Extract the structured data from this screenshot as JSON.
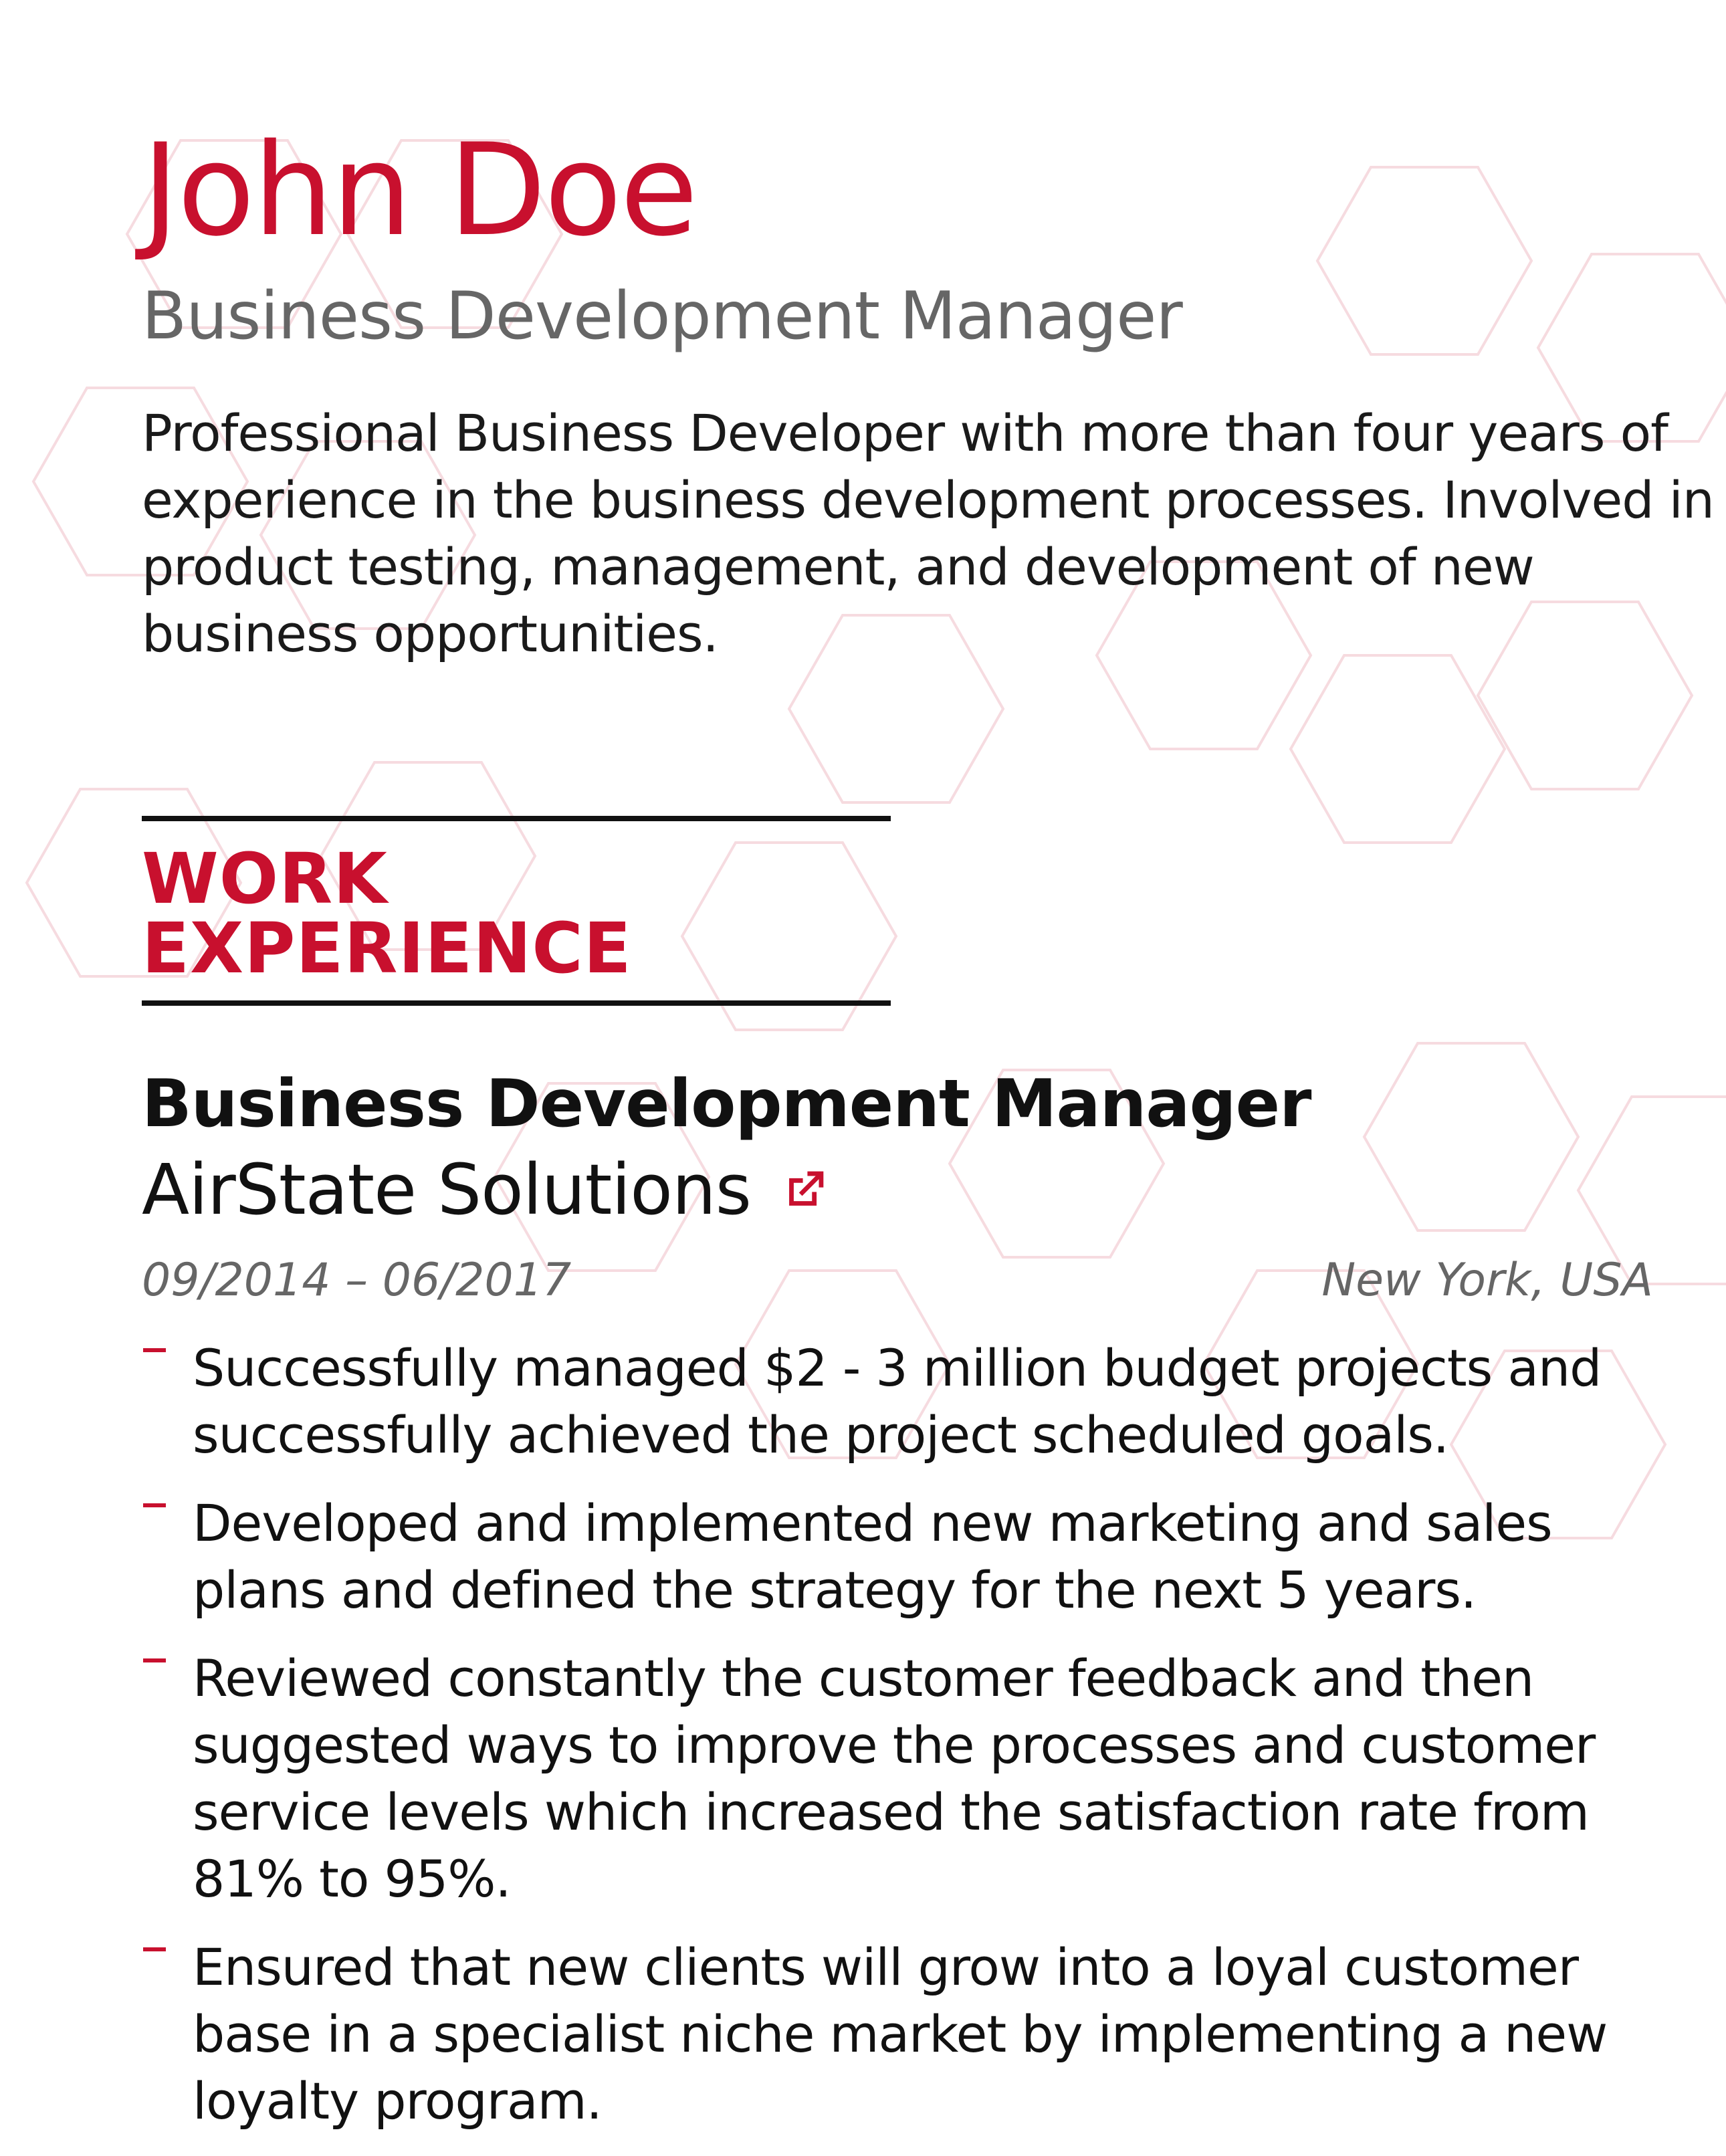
{
  "person": {
    "name": "John Doe",
    "headline": "Business Development Manager",
    "summary_lines": [
      "Professional Business Developer with more than four years of",
      "experience in the business development processes. Involved in",
      "product testing, management, and development of new",
      "business opportunities."
    ]
  },
  "work_experience": {
    "section_title": "WORK EXPERIENCE",
    "jobs": [
      {
        "title": "Business Development Manager",
        "company": "AirState Solutions",
        "dates": "09/2014 – 06/2017",
        "location": "New York, USA",
        "bullets": [
          {
            "lines": [
              "Successfully managed $2 - 3 million budget projects and",
              "successfully achieved the project scheduled goals."
            ]
          },
          {
            "lines": [
              "Developed and implemented new marketing and sales",
              "plans and defined the strategy for the next 5 years."
            ]
          },
          {
            "lines": [
              "Reviewed constantly the customer feedback and then",
              "suggested ways to improve the processes and customer",
              "service levels which increased the satisfaction rate from",
              "81% to 95%."
            ]
          },
          {
            "lines": [
              "Ensured that new clients will grow into a loyal customer",
              "base in a specialist niche market by implementing a new",
              "loyalty program."
            ]
          }
        ]
      }
    ]
  },
  "icons": {
    "company_link": "external-link-icon"
  },
  "colors": {
    "accent": "#c8102e",
    "muted": "#666666",
    "text": "#1a1a1a",
    "hexagon_pattern": "#f3cfd5"
  }
}
